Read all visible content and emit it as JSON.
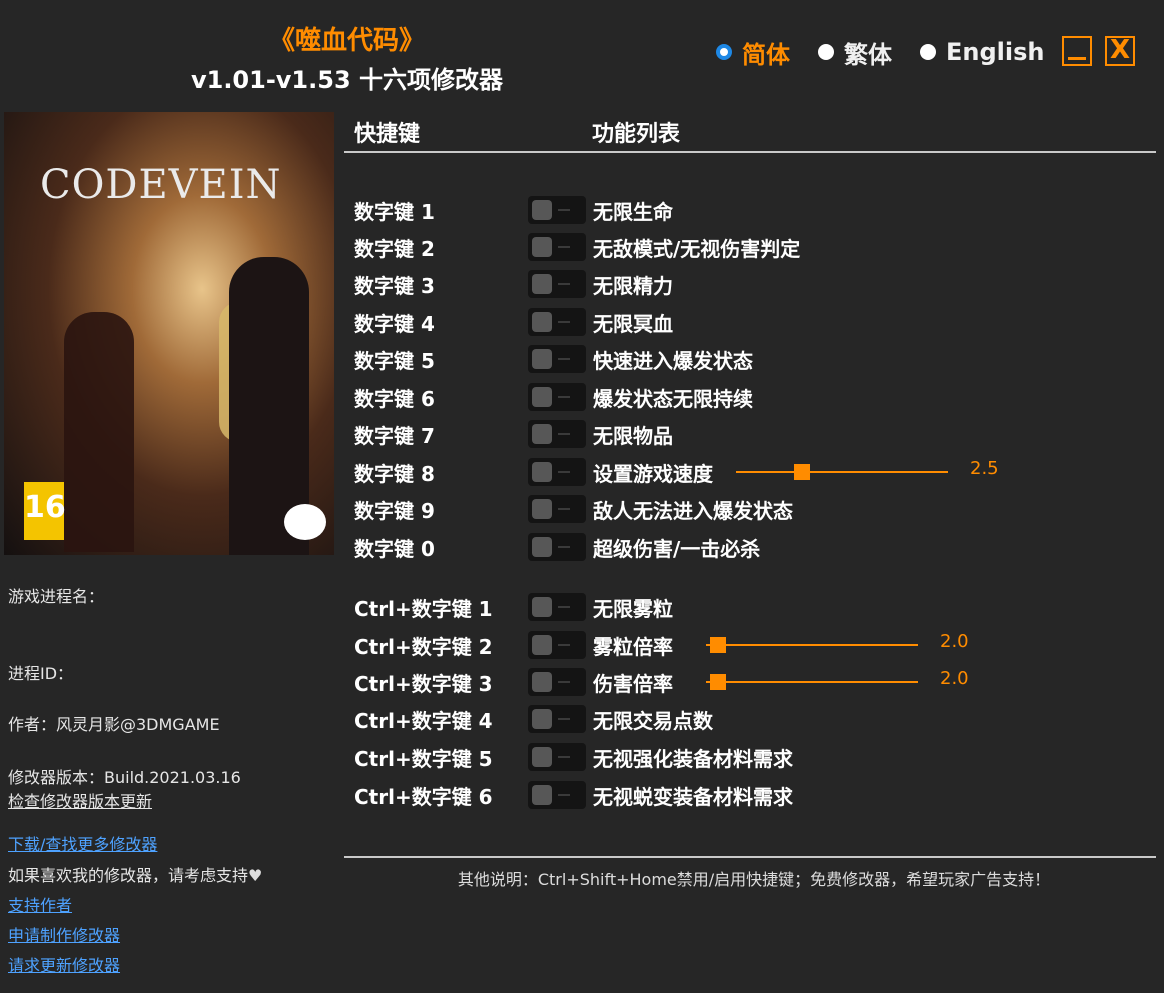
{
  "header": {
    "game_title": "《噬血代码》",
    "version": "v1.01-v1.53 十六项修改器"
  },
  "languages": [
    {
      "label": "简体",
      "selected": true
    },
    {
      "label": "繁体",
      "selected": false
    },
    {
      "label": "English",
      "selected": false
    }
  ],
  "window": {
    "close_glyph": "X"
  },
  "cover": {
    "logo_text": "CODEVEIN",
    "pegi": "16"
  },
  "info": {
    "process_name_label": "游戏进程名：",
    "process_id_label": "进程ID：",
    "author": "作者：风灵月影@3DMGAME",
    "trainer_version": "修改器版本：Build.2021.03.16",
    "check_update": "检查修改器版本更新",
    "download_more": "下载/查找更多修改器",
    "support_text": "如果喜欢我的修改器，请考虑支持",
    "heart": "♥",
    "support_author": "支持作者",
    "request_make": "申请制作修改器",
    "request_update": "请求更新修改器"
  },
  "table": {
    "col_hotkey": "快捷键",
    "col_function": "功能列表",
    "rows": [
      {
        "key": "数字键 1",
        "func": "无限生命"
      },
      {
        "key": "数字键 2",
        "func": "无敌模式/无视伤害判定"
      },
      {
        "key": "数字键 3",
        "func": "无限精力"
      },
      {
        "key": "数字键 4",
        "func": "无限冥血"
      },
      {
        "key": "数字键 5",
        "func": "快速进入爆发状态"
      },
      {
        "key": "数字键 6",
        "func": "爆发状态无限持续"
      },
      {
        "key": "数字键 7",
        "func": "无限物品"
      },
      {
        "key": "数字键 8",
        "func": "设置游戏速度",
        "slider_value": "2.5"
      },
      {
        "key": "数字键 9",
        "func": "敌人无法进入爆发状态"
      },
      {
        "key": "数字键 0",
        "func": "超级伤害/一击必杀"
      },
      {
        "key": "Ctrl+数字键 1",
        "func": "无限雾粒"
      },
      {
        "key": "Ctrl+数字键 2",
        "func": "雾粒倍率",
        "slider_value": "2.0"
      },
      {
        "key": "Ctrl+数字键 3",
        "func": "伤害倍率",
        "slider_value": "2.0"
      },
      {
        "key": "Ctrl+数字键 4",
        "func": "无限交易点数"
      },
      {
        "key": "Ctrl+数字键 5",
        "func": "无视强化装备材料需求"
      },
      {
        "key": "Ctrl+数字键 6",
        "func": "无视蜕变装备材料需求"
      }
    ]
  },
  "footer": {
    "note": "其他说明：Ctrl+Shift+Home禁用/启用快捷键；免费修改器，希望玩家广告支持！"
  },
  "colors": {
    "accent": "#ff8c00",
    "link": "#4ea2ff",
    "radio_selected": "#1e88e5"
  }
}
